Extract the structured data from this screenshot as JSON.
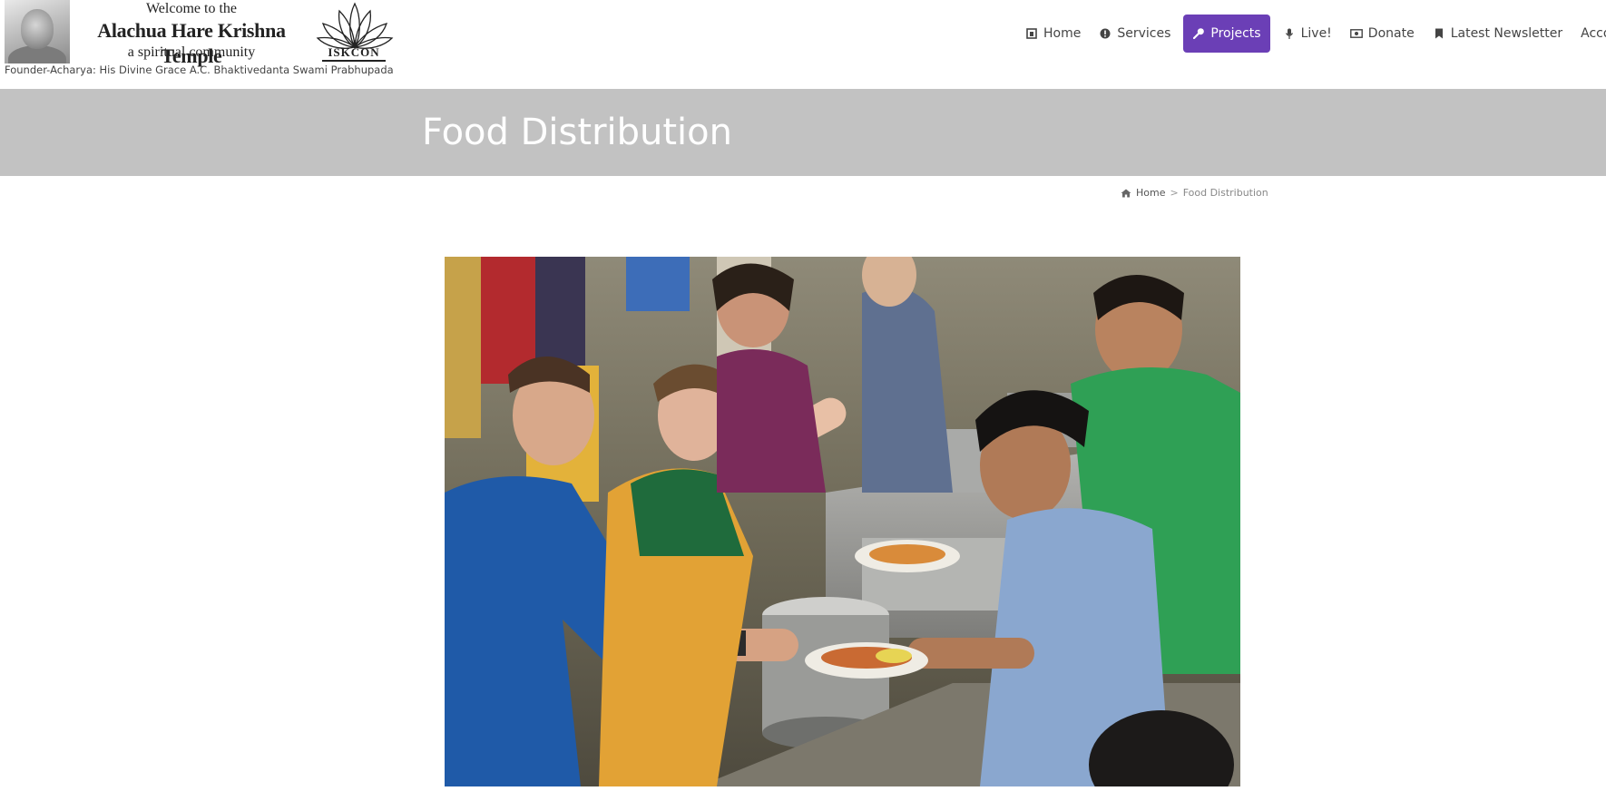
{
  "header": {
    "logo": {
      "welcome": "Welcome to the",
      "name": "Alachua Hare Krishna Temple",
      "tagline": "a spiritual community",
      "iskcon": "ISKCON"
    },
    "founder": "Founder-Acharya: His Divine Grace A.C. Bhaktivedanta Swami Prabhupada"
  },
  "nav": {
    "items": [
      {
        "label": "Home",
        "icon": "home-icon"
      },
      {
        "label": "Services",
        "icon": "info-circle-icon"
      },
      {
        "label": "Projects",
        "icon": "wrench-icon",
        "active": true
      },
      {
        "label": "Live!",
        "icon": "microphone-icon"
      },
      {
        "label": "Donate",
        "icon": "money-icon"
      },
      {
        "label": "Latest Newsletter",
        "icon": "bookmark-icon"
      },
      {
        "label": "Accommodatio",
        "icon": ""
      }
    ],
    "active_color": "#6b3fb6"
  },
  "page": {
    "title": "Food Distribution",
    "banner_color": "#c2c2c2"
  },
  "breadcrumb": {
    "home": "Home",
    "separator": ">",
    "current": "Food Distribution"
  },
  "photo": {
    "subject": "food-distribution-photo"
  }
}
